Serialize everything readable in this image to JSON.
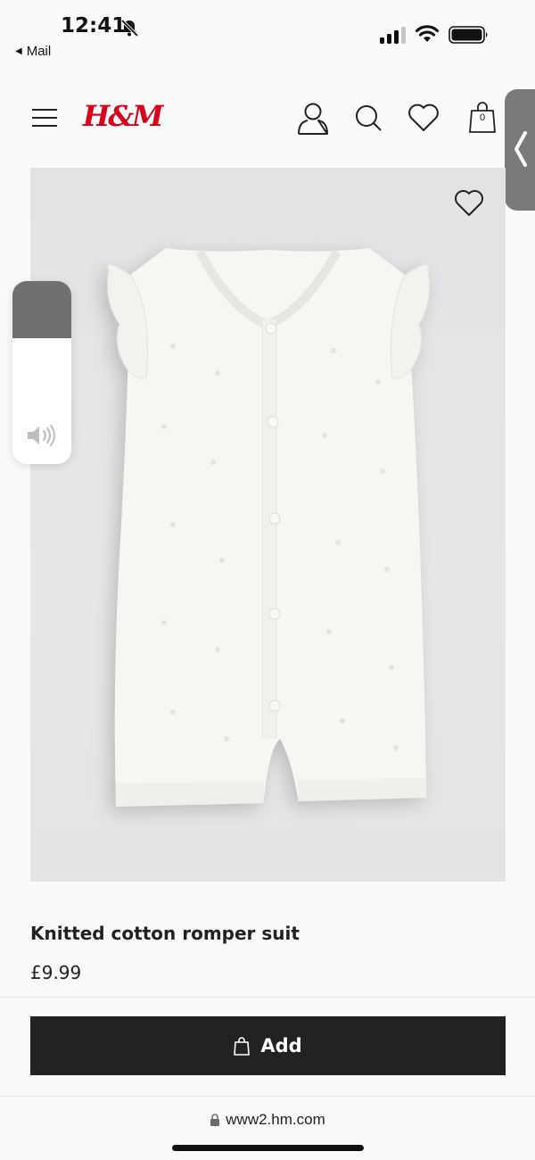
{
  "status_bar": {
    "time": "12:41",
    "back_app": "Mail",
    "icons": [
      "bell-slash-icon",
      "signal-icon",
      "wifi-icon",
      "battery-icon"
    ]
  },
  "header": {
    "logo": "H&M",
    "icons": [
      "menu-icon",
      "account-icon",
      "search-icon",
      "favorites-icon",
      "bag-icon"
    ],
    "bag_count": "0",
    "brand_color": "#d6001c"
  },
  "volume_hud": {
    "icon": "speaker-icon",
    "level": 0.69
  },
  "product": {
    "title": "Knitted cotton romper suit",
    "price": "£9.99",
    "image_icon": "favorite-heart-icon"
  },
  "add_bar": {
    "label": "Add",
    "icon": "shopping-bag-icon",
    "button_color": "#222222"
  },
  "url_bar": {
    "url": "www2.hm.com",
    "icon": "lock-icon"
  }
}
